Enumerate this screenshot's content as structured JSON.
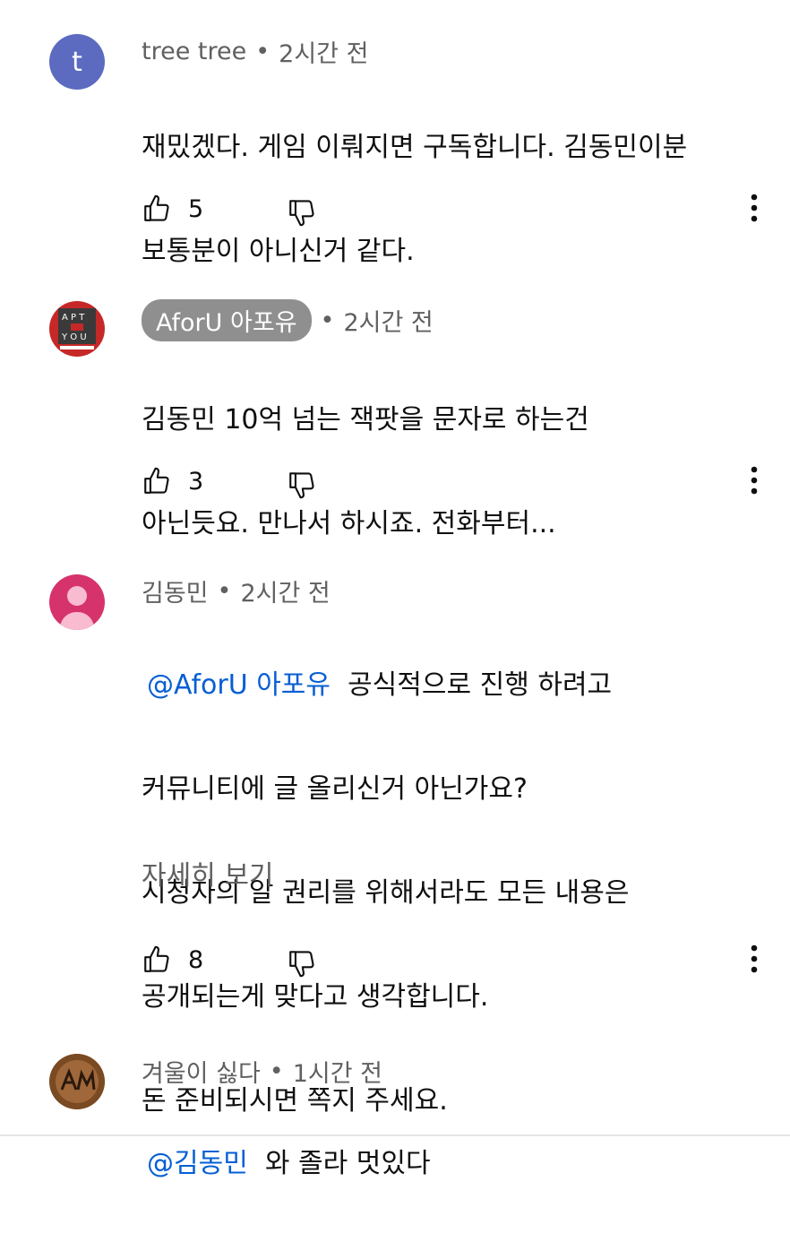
{
  "comments": [
    {
      "author": "tree tree",
      "time": "2시간 전",
      "avatar_letter": "t",
      "avatar_color": "#5c6bc0",
      "lines": [
        "재밌겠다. 게임 이뤄지면 구독합니다.  김동민이분",
        "보통분이 아니신거 같다."
      ],
      "likes": "5"
    },
    {
      "author": "AforU 아포유",
      "time": "2시간 전",
      "avatar_letters": [
        "A",
        "P",
        "T",
        "Y",
        "O",
        "U"
      ],
      "avatar_small": "www.aforu.co.kr",
      "lines": [
        "김동민 10억 넘는 잭팟을 문자로 하는건",
        "아닌듯요. 만나서 하시죠. 전화부터..."
      ],
      "likes": "3"
    },
    {
      "author": "김동민",
      "time": "2시간 전",
      "avatar_color": "#d6336c",
      "mention": "@AforU 아포유",
      "first_line_rest": "  공식적으로 진행 하려고",
      "lines": [
        "커뮤니티에 글 올리신거 아닌가요?",
        "시청자의 알 권리를 위해서라도 모든 내용은",
        "공개되는게 맞다고 생각합니다.",
        "돈 준비되시면 쪽지 주세요."
      ],
      "read_more": "자세히 보기",
      "likes": "8"
    },
    {
      "author": "겨울이 싫다",
      "time": "1시간 전",
      "avatar_color": "#8b5a2b",
      "mention": "@김동민",
      "first_line_rest": "  와 졸라 멋있다"
    }
  ],
  "separator": "•",
  "icons": {
    "like": "thumbs-up-icon",
    "dislike": "thumbs-down-icon",
    "more": "more-vert-icon"
  }
}
